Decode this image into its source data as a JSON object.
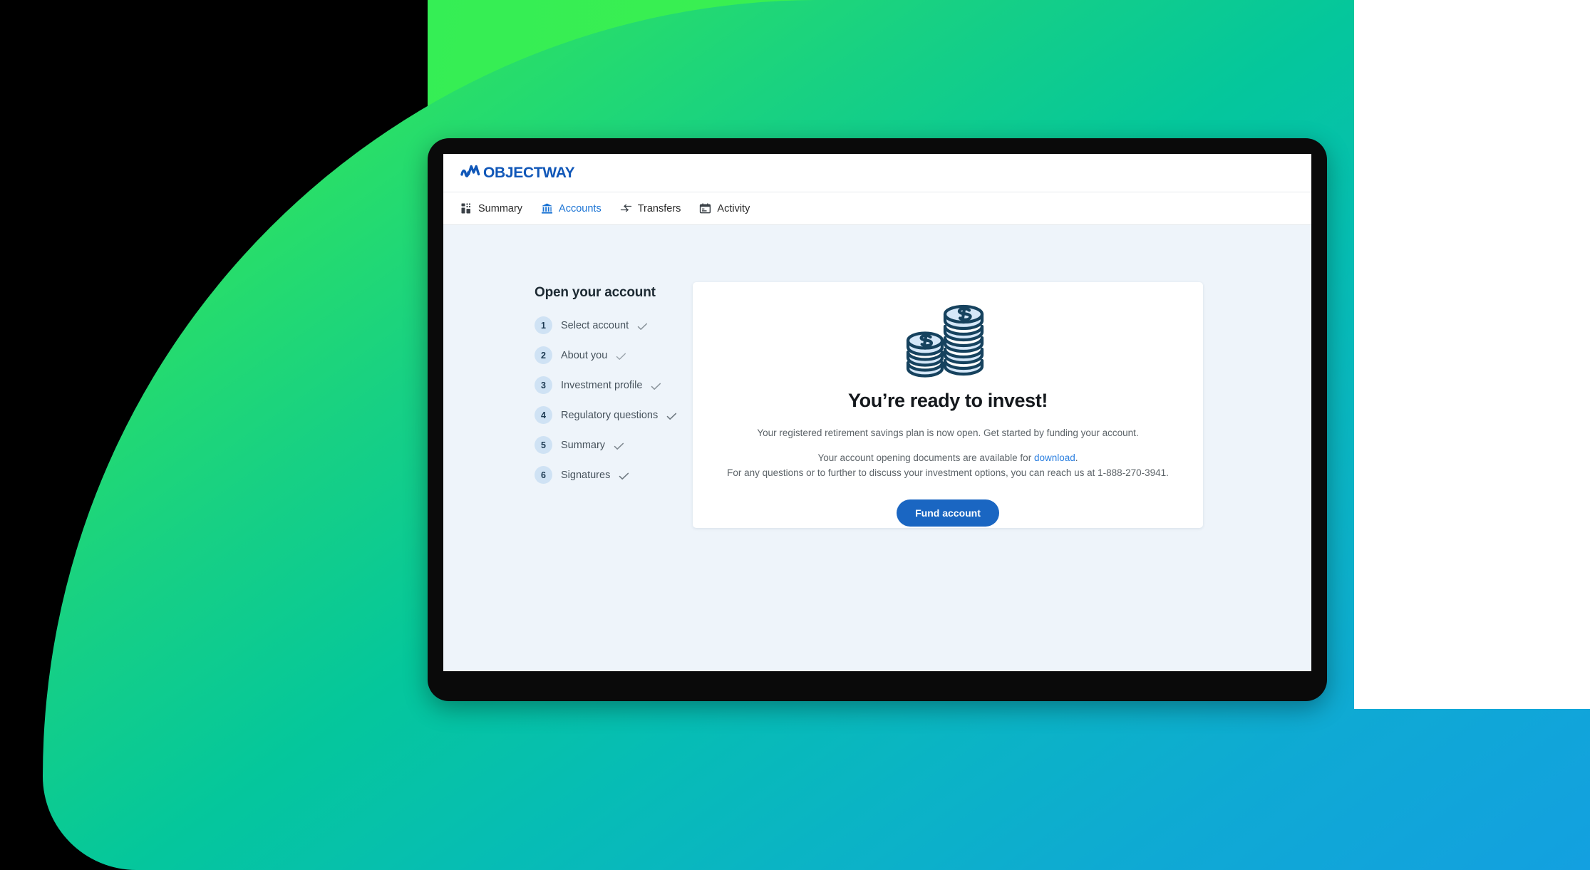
{
  "brand": {
    "logo_text": "OBJECTWAY",
    "logo_mark_icon": "wave-mark-icon",
    "primary_blue": "#1057b8",
    "accent_blue": "#1a66c2",
    "link_blue": "#2a7fe0"
  },
  "nav": {
    "items": [
      {
        "label": "Summary",
        "icon": "dashboard-grid-icon",
        "active": false
      },
      {
        "label": "Accounts",
        "icon": "bank-building-icon",
        "active": true
      },
      {
        "label": "Transfers",
        "icon": "transfer-arrows-icon",
        "active": false
      },
      {
        "label": "Activity",
        "icon": "calendar-icon",
        "active": false
      }
    ]
  },
  "steps_panel": {
    "title": "Open your account",
    "steps": [
      {
        "number": "1",
        "label": "Select account",
        "completed": true
      },
      {
        "number": "2",
        "label": "About you",
        "completed": true
      },
      {
        "number": "3",
        "label": "Investment profile",
        "completed": true
      },
      {
        "number": "4",
        "label": "Regulatory questions",
        "completed": true
      },
      {
        "number": "5",
        "label": "Summary",
        "completed": true
      },
      {
        "number": "6",
        "label": "Signatures",
        "completed": true
      }
    ]
  },
  "card": {
    "illustration_icon": "coin-stacks-icon",
    "heading": "You’re ready to invest!",
    "lead_paragraph": "Your registered retirement savings plan is now open. Get started by funding your account.",
    "documents_text_before_link": "Your account opening documents are available for ",
    "documents_link_label": "download",
    "documents_text_after_link": ".",
    "contact_line": "For any questions or to further to discuss your investment options, you can reach us at 1-888-270-3941.",
    "phone_number": "1-888-270-3941",
    "primary_button_label": "Fund account"
  }
}
